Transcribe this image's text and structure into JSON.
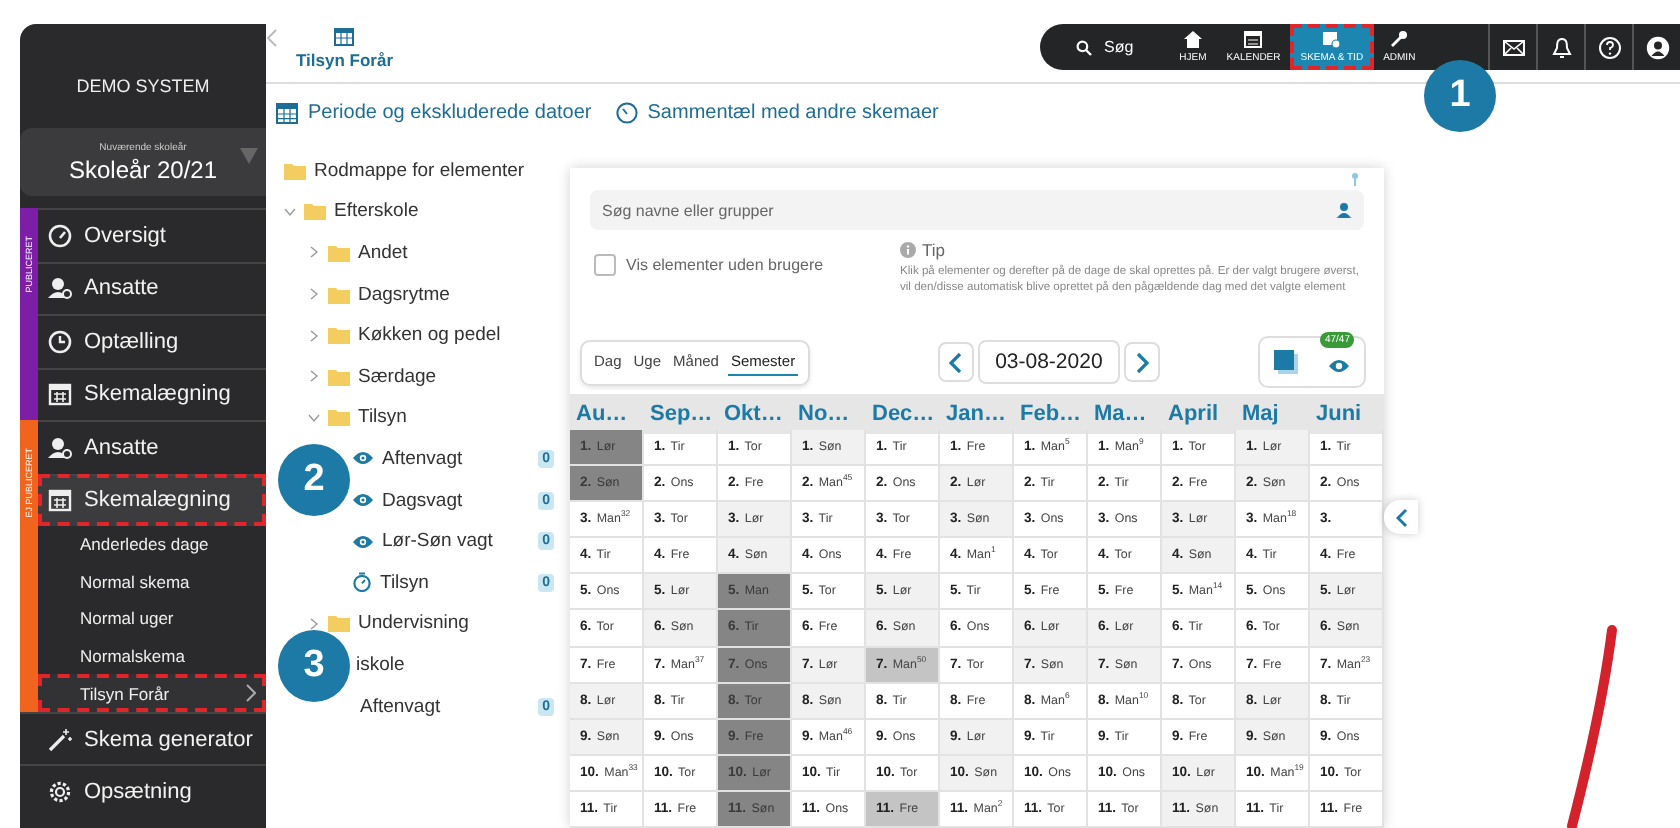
{
  "sidebar": {
    "title": "DEMO SYSTEM",
    "year_label": "Nuværende skoleår",
    "year": "Skoleår 20/21",
    "sections": [
      {
        "label": "PUBLICERET",
        "color": "#7d1fa6",
        "items": [
          {
            "label": "Oversigt",
            "selected": false,
            "marked": false
          },
          {
            "label": "Ansatte",
            "selected": false,
            "marked": false
          },
          {
            "label": "Optælling",
            "selected": false,
            "marked": false
          },
          {
            "label": "Skemalægning",
            "selected": false,
            "marked": false
          }
        ]
      },
      {
        "label": "EJ PUBLICERET",
        "color": "#f0641e",
        "items": [
          {
            "label": "Ansatte",
            "selected": false,
            "marked": false
          },
          {
            "label": "Skemalægning",
            "selected": true,
            "marked": true,
            "children": [
              {
                "label": "Anderledes dage",
                "selected": false,
                "marked": false
              },
              {
                "label": "Normal skema",
                "selected": false,
                "marked": false
              },
              {
                "label": "Normal uger",
                "selected": false,
                "marked": false
              },
              {
                "label": "Normalskema",
                "selected": false,
                "marked": false
              },
              {
                "label": "Tilsyn Forår",
                "selected": true,
                "marked": true
              }
            ]
          }
        ]
      }
    ],
    "footer_items": [
      {
        "label": "Skema generator",
        "selected": false,
        "marked": false
      },
      {
        "label": "Opsætning",
        "selected": false,
        "marked": false
      }
    ]
  },
  "page_tab": "Tilsyn Forår",
  "topbar": {
    "search": "Søg",
    "items": [
      {
        "label": "HJEM",
        "selected": false,
        "marked": false
      },
      {
        "label": "KALENDER",
        "selected": false,
        "marked": false
      },
      {
        "label": "SKEMA & TID",
        "selected": true,
        "marked": true
      },
      {
        "label": "ADMIN",
        "selected": false,
        "marked": false
      }
    ]
  },
  "toolbar": [
    "Periode og ekskluderede datoer",
    "Sammentæl med andre skemaer"
  ],
  "tree": [
    {
      "label": "Rodmappe for elementer",
      "kind": "folder"
    },
    {
      "label": "Efterskole",
      "kind": "folder",
      "expanded": true,
      "children": [
        {
          "label": "Andet",
          "kind": "folder",
          "expanded": false
        },
        {
          "label": "Dagsrytme",
          "kind": "folder",
          "expanded": false
        },
        {
          "label": "Køkken og pedel",
          "kind": "folder",
          "expanded": false
        },
        {
          "label": "Særdage",
          "kind": "folder",
          "expanded": false
        },
        {
          "label": "Tilsyn",
          "kind": "folder",
          "expanded": true,
          "children": [
            {
              "label": "Aftenvagt",
              "kind": "shift",
              "count": "0"
            },
            {
              "label": "Dagsvagt",
              "kind": "shift",
              "count": "0"
            },
            {
              "label": "Lør-Søn vagt",
              "kind": "shift",
              "count": "0"
            },
            {
              "label": "Tilsyn",
              "kind": "timer",
              "count": "0"
            }
          ]
        },
        {
          "label": "Undervisning",
          "kind": "folder",
          "expanded": false
        }
      ]
    },
    {
      "label": "iskole",
      "kind": "text",
      "children": [
        {
          "label": "Aftenvagt",
          "kind": "text",
          "count": "0"
        }
      ]
    }
  ],
  "panel": {
    "search_placeholder": "Søg navne eller grupper",
    "show_without_users": {
      "label": "Vis elementer uden brugere",
      "checked": false
    },
    "tip": {
      "title": "Tip",
      "text": "Klik på elementer og derefter på de dage de skal oprettes på. Er der valgt brugere øverst, vil den/disse automatisk blive oprettet på den pågældende dag med det valgte element"
    },
    "views": [
      {
        "label": "Dag",
        "selected": false
      },
      {
        "label": "Uge",
        "selected": false
      },
      {
        "label": "Måned",
        "selected": false
      },
      {
        "label": "Semester",
        "selected": true
      }
    ],
    "date": "03-08-2020",
    "visible_count": "47/47"
  },
  "calendar": {
    "months": [
      {
        "name": "Au…",
        "days": [
          {
            "text": "**1.** Lør",
            "kind": "excluded"
          },
          {
            "text": "**2.** Søn",
            "kind": "excluded"
          },
          {
            "text": "**3.** Man$^{32}$",
            "kind": "workday"
          },
          {
            "text": "**4.** Tir",
            "kind": "workday"
          },
          {
            "text": "**5.** Ons",
            "kind": "workday"
          },
          {
            "text": "**6.** Tor",
            "kind": "workday"
          },
          {
            "text": "**7.** Fre",
            "kind": "workday"
          },
          {
            "text": "**8.** Lør",
            "kind": "weekend"
          },
          {
            "text": "**9.** Søn",
            "kind": "weekend"
          },
          {
            "text": "**10.** Man$^{33}$",
            "kind": "workday"
          },
          {
            "text": "**11.** Tir",
            "kind": "workday"
          }
        ]
      },
      {
        "name": "Sep…",
        "days": [
          {
            "text": "**1.** Tir",
            "kind": "workday"
          },
          {
            "text": "**2.** Ons",
            "kind": "workday"
          },
          {
            "text": "**3.** Tor",
            "kind": "workday"
          },
          {
            "text": "**4.** Fre",
            "kind": "workday"
          },
          {
            "text": "**5.** Lør",
            "kind": "weekend"
          },
          {
            "text": "**6.** Søn",
            "kind": "weekend"
          },
          {
            "text": "**7.** Man$^{37}$",
            "kind": "workday"
          },
          {
            "text": "**8.** Tir",
            "kind": "workday"
          },
          {
            "text": "**9.** Ons",
            "kind": "workday"
          },
          {
            "text": "**10.** Tor",
            "kind": "workday"
          },
          {
            "text": "**11.** Fre",
            "kind": "workday"
          }
        ]
      },
      {
        "name": "Okt…",
        "days": [
          {
            "text": "**1.** Tor",
            "kind": "workday"
          },
          {
            "text": "**2.** Fre",
            "kind": "workday"
          },
          {
            "text": "**3.** Lør",
            "kind": "weekend"
          },
          {
            "text": "**4.** Søn",
            "kind": "weekend"
          },
          {
            "text": "**5.** Man",
            "kind": "excluded"
          },
          {
            "text": "**6.** Tir",
            "kind": "excluded"
          },
          {
            "text": "**7.** Ons",
            "kind": "excluded"
          },
          {
            "text": "**8.** Tor",
            "kind": "excluded"
          },
          {
            "text": "**9.** Fre",
            "kind": "excluded"
          },
          {
            "text": "**10.** Lør",
            "kind": "excluded"
          },
          {
            "text": "**11.** Søn",
            "kind": "excluded"
          }
        ]
      },
      {
        "name": "No…",
        "days": [
          {
            "text": "**1.** Søn",
            "kind": "weekend"
          },
          {
            "text": "**2.** Man$^{45}$",
            "kind": "workday"
          },
          {
            "text": "**3.** Tir",
            "kind": "workday"
          },
          {
            "text": "**4.** Ons",
            "kind": "workday"
          },
          {
            "text": "**5.** Tor",
            "kind": "workday"
          },
          {
            "text": "**6.** Fre",
            "kind": "workday"
          },
          {
            "text": "**7.** Lør",
            "kind": "weekend"
          },
          {
            "text": "**8.** Søn",
            "kind": "weekend"
          },
          {
            "text": "**9.** Man$^{46}$",
            "kind": "workday"
          },
          {
            "text": "**10.** Tir",
            "kind": "workday"
          },
          {
            "text": "**11.** Ons",
            "kind": "workday"
          }
        ]
      },
      {
        "name": "Dec…",
        "days": [
          {
            "text": "**1.** Tir",
            "kind": "workday"
          },
          {
            "text": "**2.** Ons",
            "kind": "workday"
          },
          {
            "text": "**3.** Tor",
            "kind": "workday"
          },
          {
            "text": "**4.** Fre",
            "kind": "workday"
          },
          {
            "text": "**5.** Lør",
            "kind": "weekend"
          },
          {
            "text": "**6.** Søn",
            "kind": "weekend"
          },
          {
            "text": "**7.** Man$^{50}$",
            "kind": "marked"
          },
          {
            "text": "**8.** Tir",
            "kind": "workday"
          },
          {
            "text": "**9.** Ons",
            "kind": "workday"
          },
          {
            "text": "**10.** Tor",
            "kind": "workday"
          },
          {
            "text": "**11.** Fre",
            "kind": "marked"
          }
        ]
      },
      {
        "name": "Jan…",
        "days": [
          {
            "text": "**1.** Fre",
            "kind": "workday"
          },
          {
            "text": "**2.** Lør",
            "kind": "weekend"
          },
          {
            "text": "**3.** Søn",
            "kind": "weekend"
          },
          {
            "text": "**4.** Man$^{1}$",
            "kind": "workday"
          },
          {
            "text": "**5.** Tir",
            "kind": "workday"
          },
          {
            "text": "**6.** Ons",
            "kind": "workday"
          },
          {
            "text": "**7.** Tor",
            "kind": "workday"
          },
          {
            "text": "**8.** Fre",
            "kind": "workday"
          },
          {
            "text": "**9.** Lør",
            "kind": "weekend"
          },
          {
            "text": "**10.** Søn",
            "kind": "weekend"
          },
          {
            "text": "**11.** Man$^{2}$",
            "kind": "workday"
          }
        ]
      },
      {
        "name": "Feb…",
        "days": [
          {
            "text": "**1.** Man$^{5}$",
            "kind": "workday"
          },
          {
            "text": "**2.** Tir",
            "kind": "workday"
          },
          {
            "text": "**3.** Ons",
            "kind": "workday"
          },
          {
            "text": "**4.** Tor",
            "kind": "workday"
          },
          {
            "text": "**5.** Fre",
            "kind": "workday"
          },
          {
            "text": "**6.** Lør",
            "kind": "weekend"
          },
          {
            "text": "**7.** Søn",
            "kind": "weekend"
          },
          {
            "text": "**8.** Man$^{6}$",
            "kind": "workday"
          },
          {
            "text": "**9.** Tir",
            "kind": "workday"
          },
          {
            "text": "**10.** Ons",
            "kind": "workday"
          },
          {
            "text": "**11.** Tor",
            "kind": "workday"
          }
        ]
      },
      {
        "name": "Ma…",
        "days": [
          {
            "text": "**1.** Man$^{9}$",
            "kind": "workday"
          },
          {
            "text": "**2.** Tir",
            "kind": "workday"
          },
          {
            "text": "**3.** Ons",
            "kind": "workday"
          },
          {
            "text": "**4.** Tor",
            "kind": "workday"
          },
          {
            "text": "**5.** Fre",
            "kind": "workday"
          },
          {
            "text": "**6.** Lør",
            "kind": "weekend"
          },
          {
            "text": "**7.** Søn",
            "kind": "weekend"
          },
          {
            "text": "**8.** Man$^{10}$",
            "kind": "workday"
          },
          {
            "text": "**9.** Tir",
            "kind": "workday"
          },
          {
            "text": "**10.** Ons",
            "kind": "workday"
          },
          {
            "text": "**11.** Tor",
            "kind": "workday"
          }
        ]
      },
      {
        "name": "April",
        "days": [
          {
            "text": "**1.** Tor",
            "kind": "workday"
          },
          {
            "text": "**2.** Fre",
            "kind": "workday"
          },
          {
            "text": "**3.** Lør",
            "kind": "weekend"
          },
          {
            "text": "**4.** Søn",
            "kind": "weekend"
          },
          {
            "text": "**5.** Man$^{14}$",
            "kind": "workday"
          },
          {
            "text": "**6.** Tir",
            "kind": "workday"
          },
          {
            "text": "**7.** Ons",
            "kind": "workday"
          },
          {
            "text": "**8.** Tor",
            "kind": "workday"
          },
          {
            "text": "**9.** Fre",
            "kind": "workday"
          },
          {
            "text": "**10.** Lør",
            "kind": "weekend"
          },
          {
            "text": "**11.** Søn",
            "kind": "weekend"
          }
        ]
      },
      {
        "name": "Maj",
        "days": [
          {
            "text": "**1.** Lør",
            "kind": "weekend"
          },
          {
            "text": "**2.** Søn",
            "kind": "weekend"
          },
          {
            "text": "**3.** Man$^{18}$",
            "kind": "workday"
          },
          {
            "text": "**4.** Tir",
            "kind": "workday"
          },
          {
            "text": "**5.** Ons",
            "kind": "workday"
          },
          {
            "text": "**6.** Tor",
            "kind": "workday"
          },
          {
            "text": "**7.** Fre",
            "kind": "workday"
          },
          {
            "text": "**8.** Lør",
            "kind": "weekend"
          },
          {
            "text": "**9.** Søn",
            "kind": "weekend"
          },
          {
            "text": "**10.** Man$^{19}$",
            "kind": "workday"
          },
          {
            "text": "**11.** Tir",
            "kind": "workday"
          }
        ]
      },
      {
        "name": "Juni",
        "days": [
          {
            "text": "**1.** Tir",
            "kind": "workday"
          },
          {
            "text": "**2.** Ons",
            "kind": "workday"
          },
          {
            "text": "**3.**",
            "kind": "workday"
          },
          {
            "text": "**4.** Fre",
            "kind": "workday"
          },
          {
            "text": "**5.** Lør",
            "kind": "weekend"
          },
          {
            "text": "**6.** Søn",
            "kind": "weekend"
          },
          {
            "text": "**7.** Man$^{23}$",
            "kind": "workday"
          },
          {
            "text": "**8.** Tir",
            "kind": "workday"
          },
          {
            "text": "**9.** Ons",
            "kind": "workday"
          },
          {
            "text": "**10.** Tor",
            "kind": "workday"
          },
          {
            "text": "**11.** Fre",
            "kind": "workday"
          }
        ]
      }
    ]
  },
  "callouts": [
    {
      "number": "1"
    },
    {
      "number": "2"
    },
    {
      "number": "3"
    }
  ]
}
